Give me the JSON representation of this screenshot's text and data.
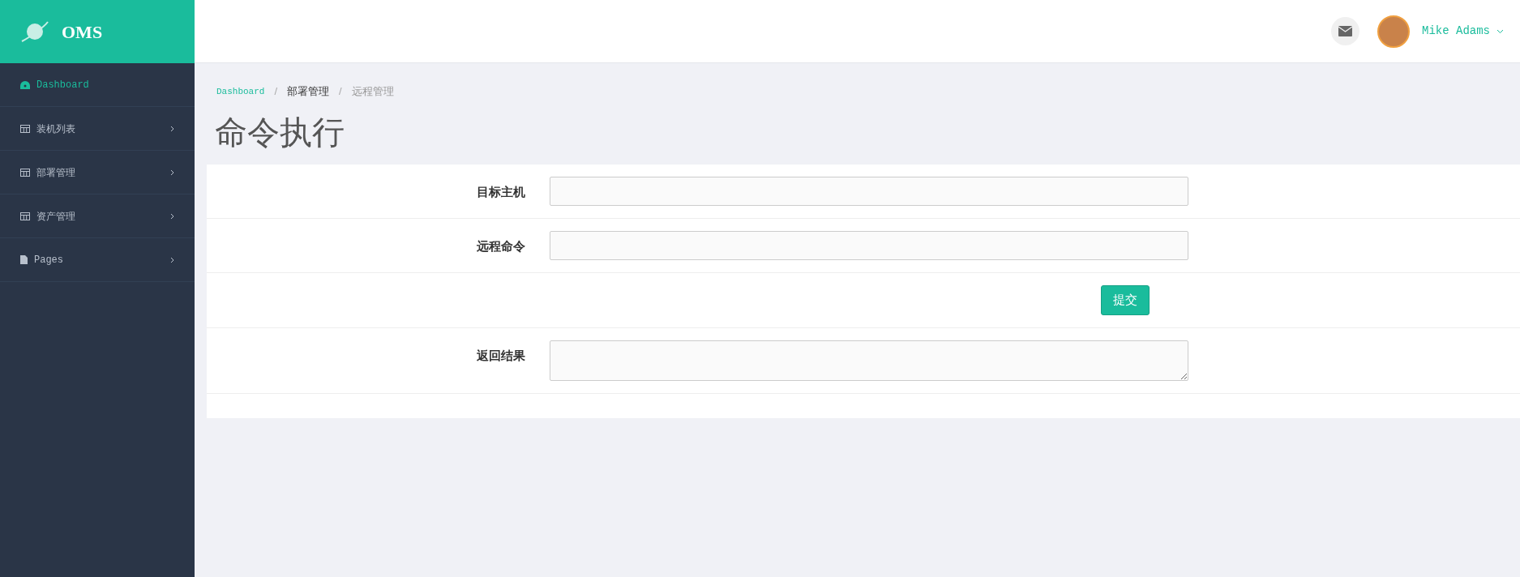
{
  "brand": {
    "title": "OMS"
  },
  "sidebar": {
    "items": [
      {
        "label": "Dashboard",
        "kind": "dashboard",
        "selected": true,
        "has_children": false
      },
      {
        "label": "装机列表",
        "kind": "table",
        "selected": false,
        "has_children": true
      },
      {
        "label": "部署管理",
        "kind": "table",
        "selected": false,
        "has_children": true
      },
      {
        "label": "资产管理",
        "kind": "table",
        "selected": false,
        "has_children": true
      },
      {
        "label": "Pages",
        "kind": "file",
        "selected": false,
        "has_children": true
      }
    ]
  },
  "header": {
    "user": {
      "name": "Mike Adams"
    }
  },
  "breadcrumb_separator": "/",
  "breadcrumb": [
    {
      "label": "Dashboard",
      "kind": "link"
    },
    {
      "label": "部署管理",
      "kind": "text"
    },
    {
      "label": "远程管理",
      "kind": "current"
    }
  ],
  "page_title": "命令执行",
  "form": {
    "rows": [
      {
        "kind": "input",
        "label": "目标主机"
      },
      {
        "kind": "input",
        "label": "远程命令"
      },
      {
        "kind": "button",
        "button": "提交"
      },
      {
        "kind": "textarea",
        "label": "返回结果"
      }
    ]
  }
}
